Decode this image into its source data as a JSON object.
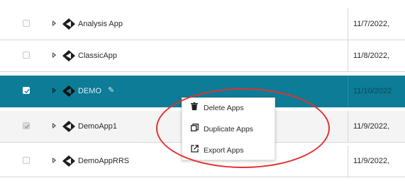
{
  "rows": [
    {
      "name": "Analysis App",
      "date": "11/7/2022,",
      "checked": false,
      "state": "normal"
    },
    {
      "name": "ClassicApp",
      "date": "11/8/2022,",
      "checked": false,
      "state": "normal"
    },
    {
      "name": "DEMO",
      "date": "11/10/2022",
      "checked": true,
      "state": "selected"
    },
    {
      "name": "DemoApp1",
      "date": "11/9/2022,",
      "checked": true,
      "state": "disabled"
    },
    {
      "name": "DemoAppRRS",
      "date": "11/9/2022,",
      "checked": false,
      "state": "normal"
    }
  ],
  "context_menu": {
    "items": [
      {
        "label": "Delete Apps",
        "icon": "trash-icon"
      },
      {
        "label": "Duplicate Apps",
        "icon": "duplicate-icon"
      },
      {
        "label": "Export Apps",
        "icon": "export-icon"
      }
    ]
  },
  "annotation": {
    "color": "#e53030",
    "shape": "ellipse"
  },
  "colors": {
    "selected_row": "#0d7c96",
    "border": "#d6d6d6"
  }
}
